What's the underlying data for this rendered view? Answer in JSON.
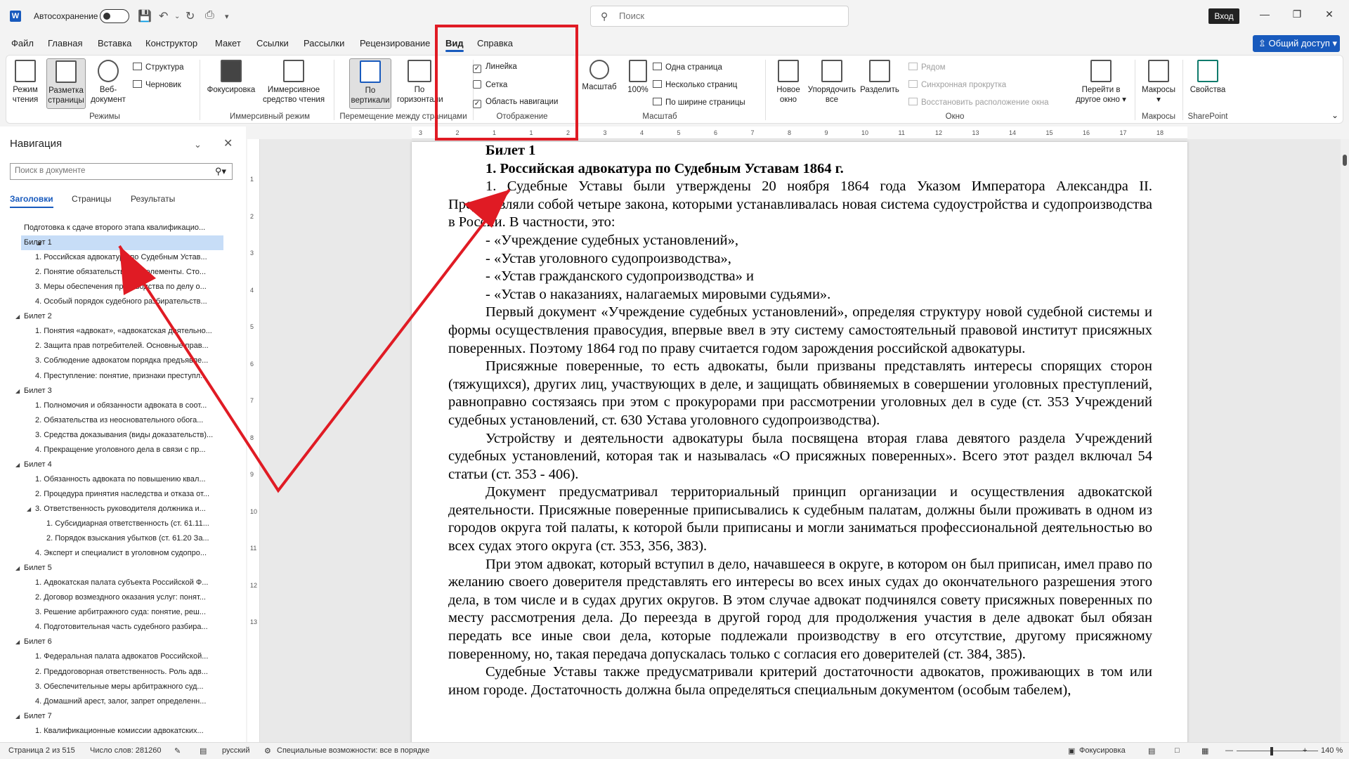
{
  "titlebar": {
    "autosave_label": "Автосохранение",
    "search_placeholder": "Поиск",
    "signin_label": "Вход"
  },
  "tabs": [
    "Файл",
    "Главная",
    "Вставка",
    "Конструктор",
    "Макет",
    "Ссылки",
    "Рассылки",
    "Рецензирование",
    "Вид",
    "Справка"
  ],
  "share_label": "Общий доступ",
  "ribbon": {
    "read_mode": "Режим чтения",
    "print_layout": "Разметка страницы",
    "web_layout": "Веб-документ",
    "outline": "Структура",
    "draft": "Черновик",
    "group_views": "Режимы",
    "focus": "Фокусировка",
    "immersive_reader": "Иммерсивное средство чтения",
    "group_immersive": "Иммерсивный режим",
    "vertical": "По вертикали",
    "side_to_side": "По горизонтали",
    "group_page_movement": "Перемещение между страницами",
    "ruler": "Линейка",
    "gridlines": "Сетка",
    "nav_pane": "Область навигации",
    "group_show": "Отображение",
    "zoom": "Масштаб",
    "zoom100": "100%",
    "one_page": "Одна страница",
    "multiple_pages": "Несколько страниц",
    "page_width": "По ширине страницы",
    "group_zoom": "Масштаб",
    "new_window": "Новое окно",
    "arrange_all": "Упорядочить все",
    "split": "Разделить",
    "side_by_side": "Рядом",
    "sync_scroll": "Синхронная прокрутка",
    "reset_position": "Восстановить расположение окна",
    "switch_windows": "Перейти в другое окно",
    "group_window": "Окно",
    "macros": "Макросы",
    "group_macros": "Макросы",
    "properties": "Свойства",
    "group_sharepoint": "SharePoint"
  },
  "nav": {
    "title": "Навигация",
    "search_placeholder": "Поиск в документе",
    "tab_headings": "Заголовки",
    "tab_pages": "Страницы",
    "tab_results": "Результаты",
    "items": [
      {
        "level": 0,
        "text": "Подготовка к сдаче второго этапа квалификацио..."
      },
      {
        "level": 1,
        "text": "Билет 1",
        "expanded": true,
        "selected": true
      },
      {
        "level": 2,
        "text": "1. Российская адвокатура по Судебным Устав..."
      },
      {
        "level": 2,
        "text": "2. Понятие обязательств и его элементы. Сто..."
      },
      {
        "level": 2,
        "text": "3. Меры обеспечения производства по делу о..."
      },
      {
        "level": 2,
        "text": "4. Особый порядок судебного разбирательств..."
      },
      {
        "level": 1,
        "text": "Билет 2",
        "expanded": true
      },
      {
        "level": 2,
        "text": "1. Понятия «адвокат», «адвокатская деятельно..."
      },
      {
        "level": 2,
        "text": "2. Защита прав потребителей. Основные прав..."
      },
      {
        "level": 2,
        "text": "3. Соблюдение адвокатом порядка предъявле..."
      },
      {
        "level": 2,
        "text": "4. Преступление: понятие, признаки преступл..."
      },
      {
        "level": 1,
        "text": "Билет 3",
        "expanded": true
      },
      {
        "level": 2,
        "text": "1. Полномочия и обязанности адвоката в соот..."
      },
      {
        "level": 2,
        "text": "2. Обязательства из неосновательного обога..."
      },
      {
        "level": 2,
        "text": "3. Средства доказывания (виды доказательств)..."
      },
      {
        "level": 2,
        "text": "4. Прекращение уголовного дела в связи с пр..."
      },
      {
        "level": 1,
        "text": "Билет 4",
        "expanded": true
      },
      {
        "level": 2,
        "text": "1. Обязанность адвоката по повышению квал..."
      },
      {
        "level": 2,
        "text": "2. Процедура принятия наследства и отказа от..."
      },
      {
        "level": 2,
        "text": "3. Ответственность руководителя должника и...",
        "expanded": true
      },
      {
        "level": 3,
        "text": "1. Субсидиарная ответственность (ст. 61.11..."
      },
      {
        "level": 3,
        "text": "2. Порядок взыскания убытков (ст. 61.20 За..."
      },
      {
        "level": 2,
        "text": "4. Эксперт и специалист в уголовном судопро..."
      },
      {
        "level": 1,
        "text": "Билет 5",
        "expanded": true
      },
      {
        "level": 2,
        "text": "1. Адвокатская палата субъекта Российской Ф..."
      },
      {
        "level": 2,
        "text": "2. Договор возмездного оказания услуг: понят..."
      },
      {
        "level": 2,
        "text": "3. Решение арбитражного суда: понятие, реш..."
      },
      {
        "level": 2,
        "text": "4. Подготовительная часть судебного разбира..."
      },
      {
        "level": 1,
        "text": "Билет 6",
        "expanded": true
      },
      {
        "level": 2,
        "text": "1. Федеральная палата адвокатов Российской..."
      },
      {
        "level": 2,
        "text": "2. Преддоговорная ответственность. Роль адв..."
      },
      {
        "level": 2,
        "text": "3. Обеспечительные меры арбитражного суд..."
      },
      {
        "level": 2,
        "text": "4. Домашний арест, залог, запрет определенн..."
      },
      {
        "level": 1,
        "text": "Билет 7",
        "expanded": true
      },
      {
        "level": 2,
        "text": "1. Квалификационные комиссии адвокатских..."
      }
    ]
  },
  "ruler_h": [
    "3",
    "2",
    "1",
    "1",
    "2",
    "3",
    "4",
    "5",
    "6",
    "7",
    "8",
    "9",
    "10",
    "11",
    "12",
    "13",
    "14",
    "15",
    "16",
    "17",
    "18"
  ],
  "ruler_v": [
    "1",
    "2",
    "3",
    "4",
    "5",
    "6",
    "7",
    "8",
    "9",
    "10",
    "11",
    "12",
    "13"
  ],
  "document": {
    "ticket": "Билет 1",
    "heading": "1. Российская адвокатура по Судебным Уставам 1864 г.",
    "p1": "1. Судебные Уставы были утверждены 20 ноября 1864 года Указом Императора Александра II. Представляли собой четыре закона, которыми устанавливалась новая система судоустройства и судопроизводства в России. В частности, это:",
    "list": [
      "- «Учреждение судебных установлений»,",
      "- «Устав уголовного судопроизводства»,",
      "- «Устав гражданского судопроизводства» и",
      "- «Устав о наказаниях, налагаемых мировыми судьями»."
    ],
    "p2": "Первый документ «Учреждение судебных установлений», определяя структуру новой судебной системы и формы осуществления правосудия, впервые ввел в эту систему самостоятельный правовой институт присяжных поверенных. Поэтому 1864 год по праву считается годом зарождения российской адвокатуры.",
    "p3": "Присяжные поверенные, то есть адвокаты, были призваны представлять интересы спорящих сторон (тяжущихся), других лиц, участвующих в деле, и защищать обвиняемых в совершении уголовных преступлений, равноправно состязаясь при этом с прокурорами при рассмотрении уголовных дел в суде (ст. 353 Учреждений судебных установлений, ст. 630 Устава уголовного судопроизводства).",
    "p4": "Устройству и деятельности адвокатуры была посвящена вторая глава девятого раздела Учреждений судебных установлений, которая так и называлась «О присяжных поверенных». Всего этот раздел включал 54 статьи (ст. 353 - 406).",
    "p5": "Документ предусматривал территориальный принцип организации и осуществления адвокатской деятельности. Присяжные поверенные приписывались к судебным палатам, должны были проживать в одном из городов округа той палаты, к которой были приписаны и могли заниматься профессиональной деятельностью во всех судах этого округа (ст. 353, 356, 383).",
    "p6": "При этом адвокат, который вступил в дело, начавшееся в округе, в котором он был приписан, имел право по желанию своего доверителя представлять его интересы во всех иных судах до окончательного разрешения этого дела, в том числе и в судах других округов. В этом случае адвокат подчинялся совету присяжных поверенных по месту рассмотрения дела. До переезда в другой город для продолжения участия в деле адвокат был обязан передать все иные свои дела, которые подлежали производству в его отсутствие, другому присяжному поверенному, но, такая передача допускалась только с согласия его доверителей (ст. 384, 385).",
    "p7": "Судебные Уставы также предусматривали критерий достаточности адвокатов, проживающих в том или ином городе. Достаточность должна была определяться специальным документом (особым табелем),"
  },
  "status": {
    "page": "Страница 2 из 515",
    "words": "Число слов: 281260",
    "language": "русский",
    "accessibility": "Специальные возможности: все в порядке",
    "focus": "Фокусировка",
    "zoom": "140 %"
  },
  "colors": {
    "accent": "#185abd",
    "annotation": "#e01b24"
  }
}
